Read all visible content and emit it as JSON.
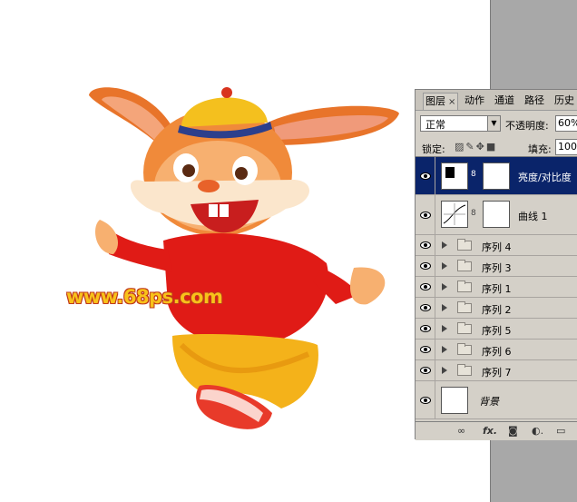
{
  "watermark": "www.68ps.com",
  "panel": {
    "tabs": [
      {
        "label": "图层",
        "close": "×"
      },
      {
        "label": "动作"
      },
      {
        "label": "通道"
      },
      {
        "label": "路径"
      },
      {
        "label": "历史"
      }
    ],
    "blend_mode": "正常",
    "opacity_label": "不透明度:",
    "opacity_value": "60%",
    "lock_label": "锁定:",
    "fill_label": "填充:",
    "fill_value": "100%",
    "layers": [
      {
        "name": "亮度/对比度",
        "type": "adjustment",
        "selected": true
      },
      {
        "name": "曲线 1",
        "type": "adjustment",
        "selected": false
      },
      {
        "name": "序列 4",
        "type": "group"
      },
      {
        "name": "序列 3",
        "type": "group"
      },
      {
        "name": "序列 1",
        "type": "group"
      },
      {
        "name": "序列 2",
        "type": "group"
      },
      {
        "name": "序列 5",
        "type": "group"
      },
      {
        "name": "序列 6",
        "type": "group"
      },
      {
        "name": "序列 7",
        "type": "group"
      },
      {
        "name": "背景",
        "type": "background"
      }
    ],
    "footer_icons": [
      "link-icon",
      "fx-icon",
      "mask-icon",
      "adjustment-icon",
      "new-group-icon"
    ]
  }
}
